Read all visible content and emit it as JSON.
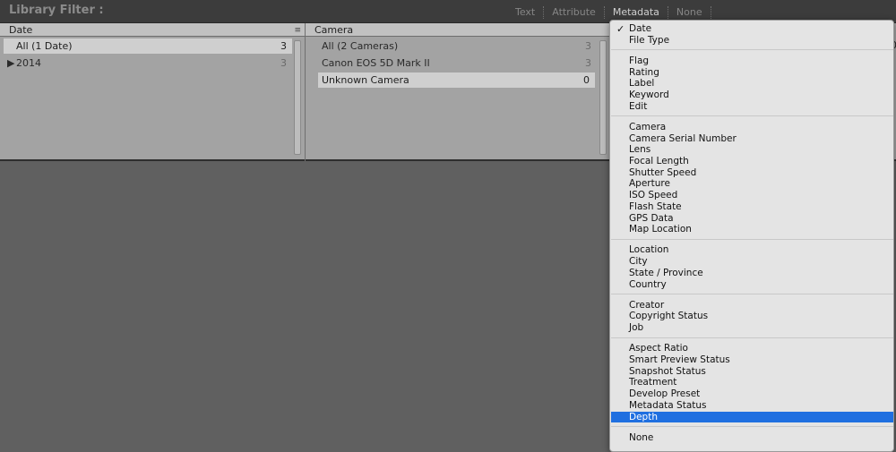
{
  "filter_bar": {
    "title": "Library Filter :",
    "tabs": [
      {
        "label": "Text",
        "active": false
      },
      {
        "label": "Attribute",
        "active": false
      },
      {
        "label": "Metadata",
        "active": true
      },
      {
        "label": "None",
        "active": false
      }
    ]
  },
  "columns": {
    "date": {
      "header": "Date",
      "rows": [
        {
          "label": "All (1 Date)",
          "count": "3"
        },
        {
          "label": "2014",
          "count": "3"
        }
      ]
    },
    "camera": {
      "header": "Camera",
      "rows": [
        {
          "label": "All (2 Cameras)",
          "count": "3"
        },
        {
          "label": "Canon EOS 5D Mark II",
          "count": "3"
        },
        {
          "label": "Unknown Camera",
          "count": "0"
        }
      ]
    },
    "edge_text": "0"
  },
  "dropdown": {
    "checked_item": "Date",
    "groups": [
      [
        "Date",
        "File Type"
      ],
      [
        "Flag",
        "Rating",
        "Label",
        "Keyword",
        "Edit"
      ],
      [
        "Camera",
        "Camera Serial Number",
        "Lens",
        "Focal Length",
        "Shutter Speed",
        "Aperture",
        "ISO Speed",
        "Flash State",
        "GPS Data",
        "Map Location"
      ],
      [
        "Location",
        "City",
        "State / Province",
        "Country"
      ],
      [
        "Creator",
        "Copyright Status",
        "Job"
      ],
      [
        "Aspect Ratio",
        "Smart Preview Status",
        "Snapshot Status",
        "Treatment",
        "Develop Preset",
        "Metadata Status",
        "Depth"
      ],
      [
        "None"
      ]
    ],
    "highlighted_item": "Depth"
  },
  "icons": {
    "column_menu": "column-options-icon",
    "disclosure": "disclosure-triangle-icon",
    "check": "checkmark-icon"
  },
  "colors": {
    "highlight": "#1f6fe0",
    "panel": "#a3a3a3",
    "background": "#606060"
  }
}
